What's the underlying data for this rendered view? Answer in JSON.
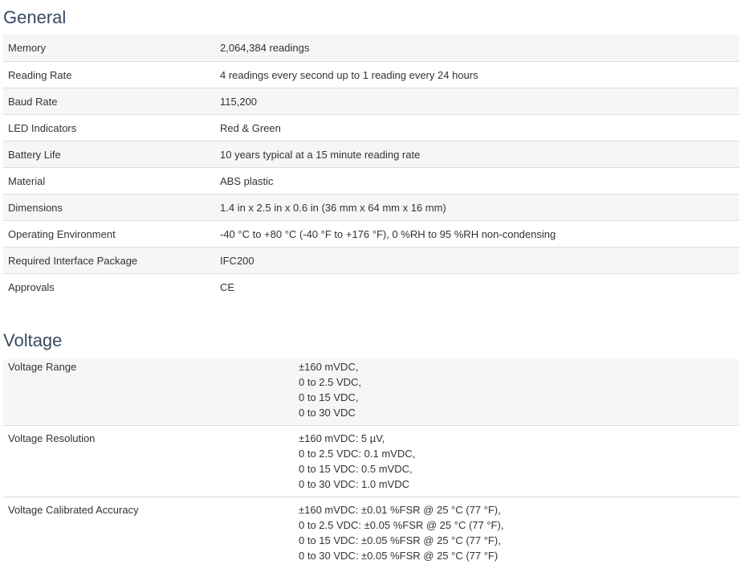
{
  "general": {
    "title": "General",
    "rows": [
      {
        "label": "Memory",
        "value": "2,064,384 readings"
      },
      {
        "label": "Reading Rate",
        "value": "4 readings every second up to 1 reading every 24 hours"
      },
      {
        "label": "Baud Rate",
        "value": "115,200"
      },
      {
        "label": "LED Indicators",
        "value": "Red & Green"
      },
      {
        "label": "Battery Life",
        "value": "10 years typical at a 15 minute reading rate"
      },
      {
        "label": "Material",
        "value": "ABS plastic"
      },
      {
        "label": "Dimensions",
        "value": "1.4 in x 2.5 in x 0.6 in (36 mm x 64 mm x 16 mm)"
      },
      {
        "label": "Operating Environment",
        "value": "-40 °C to +80 °C (-40 °F to +176 °F), 0 %RH to 95 %RH non-condensing"
      },
      {
        "label": "Required Interface Package",
        "value": "IFC200"
      },
      {
        "label": "Approvals",
        "value": "CE"
      }
    ]
  },
  "voltage": {
    "title": "Voltage",
    "rows": [
      {
        "label": "Voltage Range",
        "lines": [
          "±160 mVDC,",
          "0 to 2.5 VDC,",
          "0 to 15 VDC,",
          "0 to 30 VDC"
        ]
      },
      {
        "label": "Voltage Resolution",
        "lines": [
          "±160 mVDC: 5 µV,",
          "0 to 2.5 VDC: 0.1 mVDC,",
          "0 to 15 VDC: 0.5 mVDC,",
          "0 to 30 VDC: 1.0 mVDC"
        ]
      },
      {
        "label": "Voltage Calibrated Accuracy",
        "lines": [
          "±160 mVDC: ±0.01 %FSR @ 25 °C (77 °F),",
          "0 to 2.5 VDC: ±0.05 %FSR @ 25 °C (77 °F),",
          "0 to 15 VDC: ±0.05 %FSR @ 25 °C (77 °F),",
          "0 to 30 VDC: ±0.05 %FSR @ 25 °C (77 °F)"
        ]
      }
    ]
  }
}
